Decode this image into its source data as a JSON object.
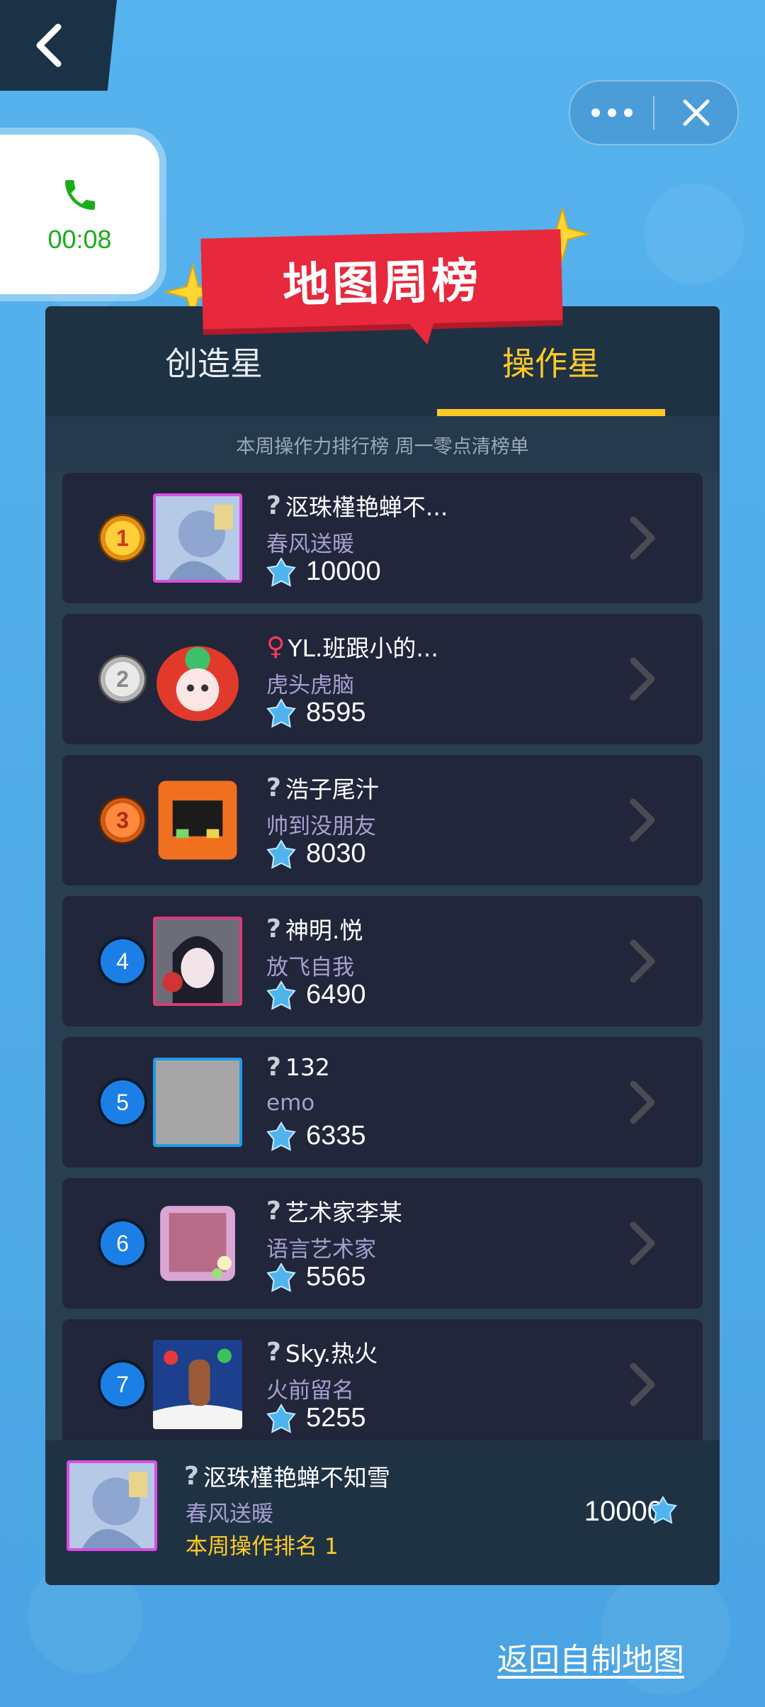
{
  "call": {
    "time": "00:08"
  },
  "title": "地图周榜",
  "tabs": [
    {
      "label": "创造星",
      "active": false
    },
    {
      "label": "操作星",
      "active": true
    }
  ],
  "subtitle": "本周操作力排行榜 周一零点清榜单",
  "rows": [
    {
      "rank": "1",
      "name": "沤珠槿艳蝉不...",
      "sign": "春风送暖",
      "score": "10000",
      "prefix": "?"
    },
    {
      "rank": "2",
      "name": "YL.班跟小的...",
      "sign": "虎头虎脑",
      "score": "8595",
      "prefix": "♀"
    },
    {
      "rank": "3",
      "name": "浩子尾汁",
      "sign": "帅到没朋友",
      "score": "8030",
      "prefix": "?"
    },
    {
      "rank": "4",
      "name": "神明.悦",
      "sign": "放飞自我",
      "score": "6490",
      "prefix": "?"
    },
    {
      "rank": "5",
      "name": "132",
      "sign": "emo",
      "score": "6335",
      "prefix": "?"
    },
    {
      "rank": "6",
      "name": "艺术家李某",
      "sign": "语言艺术家",
      "score": "5565",
      "prefix": "?"
    },
    {
      "rank": "7",
      "name": "Sky.热火",
      "sign": "火前留名",
      "score": "5255",
      "prefix": "?"
    }
  ],
  "mine": {
    "name": "沤珠槿艳蝉不知雪",
    "sign": "春风送暖",
    "rank_label": "本周操作排名 1",
    "score": "10000",
    "prefix": "?"
  },
  "back_link": "返回自制地图",
  "colors": {
    "accent": "#ffc928",
    "banner": "#e8283c",
    "panel": "#2a3e52",
    "row": "#22263a"
  }
}
